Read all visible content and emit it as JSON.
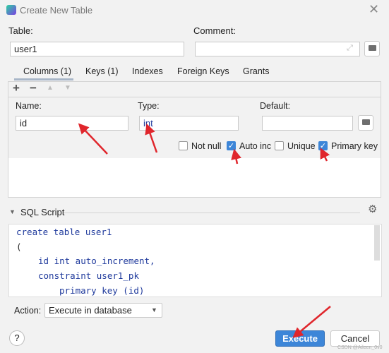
{
  "window": {
    "title": "Create New Table",
    "close_icon": "close-icon"
  },
  "table": {
    "label": "Table:",
    "value": "user1"
  },
  "comment": {
    "label": "Comment:",
    "value": ""
  },
  "tabs": [
    {
      "label": "Columns (1)",
      "active": true
    },
    {
      "label": "Keys (1)"
    },
    {
      "label": "Indexes"
    },
    {
      "label": "Foreign Keys"
    },
    {
      "label": "Grants"
    }
  ],
  "column": {
    "name_label": "Name:",
    "name_value": "id",
    "type_label": "Type:",
    "type_value": "int",
    "default_label": "Default:",
    "default_value": ""
  },
  "checkboxes": [
    {
      "label": "Not null",
      "checked": false
    },
    {
      "label": "Auto inc",
      "checked": true
    },
    {
      "label": "Unique",
      "checked": false
    },
    {
      "label": "Primary key",
      "checked": true
    }
  ],
  "sql": {
    "header": "SQL Script",
    "lines": [
      "create table user1",
      "(",
      "id int auto_increment,",
      "constraint user1_pk",
      "primary key (id)"
    ]
  },
  "action": {
    "label": "Action:",
    "value": "Execute in database"
  },
  "buttons": {
    "help": "?",
    "execute": "Execute",
    "cancel": "Cancel"
  },
  "watermark": "CSDN @Aileen_0v0",
  "colors": {
    "accent": "#3d86d8",
    "annotation_arrow": "#e0262c"
  }
}
